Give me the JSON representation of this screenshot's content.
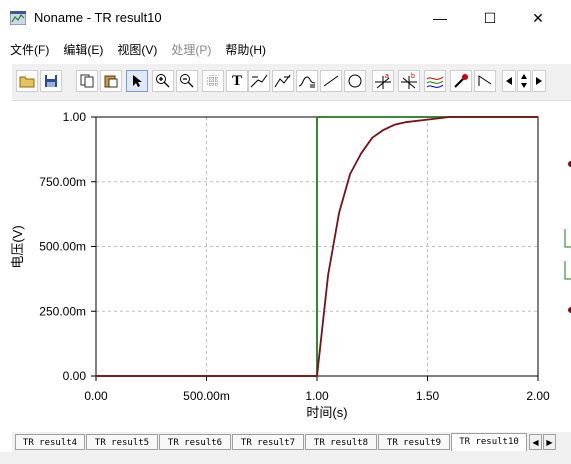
{
  "window": {
    "title": "Noname - TR result10",
    "minimize_glyph": "—",
    "maximize_glyph": "☐",
    "close_glyph": "✕"
  },
  "menu": [
    {
      "label": "文件(F)",
      "enabled": true
    },
    {
      "label": "编辑(E)",
      "enabled": true
    },
    {
      "label": "视图(V)",
      "enabled": true
    },
    {
      "label": "处理(P)",
      "enabled": false
    },
    {
      "label": "帮助(H)",
      "enabled": true
    }
  ],
  "toolbar": {
    "icons": [
      "open-folder-icon",
      "save-icon",
      "copy-icon",
      "paste-icon",
      "pointer-icon",
      "zoom-in-icon",
      "zoom-out-icon",
      "grid-icon",
      "text-icon",
      "cursor-a-icon",
      "cursor-b-icon",
      "annotate-icon",
      "line-icon",
      "circle-icon",
      "marker-a-icon",
      "marker-b-icon",
      "curves-icon",
      "probe-icon",
      "step-icon",
      "scroll-left-icon",
      "scroll-updown-icon",
      "scroll-right-icon"
    ],
    "text_tool_glyph": "T",
    "marker_a_glyph": "a",
    "marker_b_glyph": "b"
  },
  "chart_data": {
    "type": "line",
    "xlabel": "时间(s)",
    "ylabel": "电压(V)",
    "xlim": [
      0,
      2.0
    ],
    "ylim": [
      0,
      1.0
    ],
    "x_ticks": [
      {
        "value": 0,
        "label": "0.00"
      },
      {
        "value": 0.5,
        "label": "500.00m"
      },
      {
        "value": 1.0,
        "label": "1.00"
      },
      {
        "value": 1.5,
        "label": "1.50"
      },
      {
        "value": 2.0,
        "label": "2.00"
      }
    ],
    "y_ticks": [
      {
        "value": 0,
        "label": "0.00"
      },
      {
        "value": 0.25,
        "label": "250.00m"
      },
      {
        "value": 0.5,
        "label": "500.00m"
      },
      {
        "value": 0.75,
        "label": "750.00m"
      },
      {
        "value": 1.0,
        "label": "1.00"
      }
    ],
    "grid": true,
    "series": [
      {
        "color": "#1f7a1f",
        "x": [
          0,
          1.0,
          1.0,
          2.0
        ],
        "y": [
          0,
          0,
          1.0,
          1.0
        ]
      },
      {
        "color": "#7a0f1a",
        "x": [
          0,
          1.0,
          1.05,
          1.1,
          1.15,
          1.2,
          1.25,
          1.3,
          1.35,
          1.4,
          1.5,
          1.6,
          1.7,
          2.0
        ],
        "y": [
          0,
          0,
          0.39,
          0.63,
          0.78,
          0.86,
          0.92,
          0.95,
          0.97,
          0.98,
          0.99,
          1.0,
          1.0,
          1.0
        ]
      }
    ]
  },
  "tabs": [
    {
      "label": "TR result4",
      "active": false
    },
    {
      "label": "TR result5",
      "active": false
    },
    {
      "label": "TR result6",
      "active": false
    },
    {
      "label": "TR result7",
      "active": false
    },
    {
      "label": "TR result8",
      "active": false
    },
    {
      "label": "TR result9",
      "active": false
    },
    {
      "label": "TR result10",
      "active": true
    }
  ]
}
